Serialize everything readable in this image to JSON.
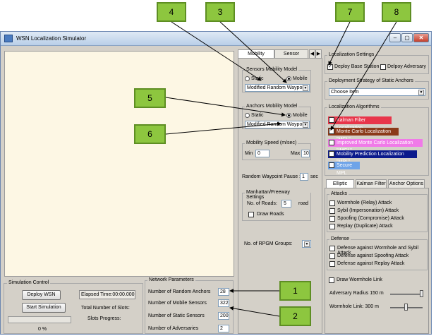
{
  "window": {
    "title": "WSN Localization Simulator",
    "min": "–",
    "max": "▢",
    "close": "✕"
  },
  "mobility_panel": {
    "tabs": [
      "Mobility Settings",
      "Sensor Settings"
    ],
    "tab_arrows": [
      "◀",
      "▶"
    ],
    "sensors_group": "Sensors Mobility Model",
    "anchors_group": "Anchors Mobility Model",
    "static_label": "Static",
    "mobile_label": "Mobile",
    "sensors_model": "Modified Random Waypoint",
    "anchors_model": "Modified Random Waypoint",
    "speed_group": "Mobility Speed  (m/sec)",
    "min_label": "Min",
    "min_value": "0",
    "max_label": "Max",
    "max_value": "10",
    "pause_label": "Random Waypoint Pause :",
    "pause_value": "1",
    "pause_unit": "sec",
    "manhattan_group": "Manhattan/Freeway Settings",
    "roads_label": "No. of Roads:",
    "roads_value": "5",
    "roads_unit": "road",
    "draw_roads": "Draw Roads",
    "rpgm_label": "No. of RPGM Groups:",
    "rpgm_value": ""
  },
  "localization": {
    "group": "Localization Settings",
    "deploy_base": "Deploy Base Station",
    "deploy_adversary": "Delpoy Adversary",
    "deployment_group": "Deployment Strategy of Static Anchors",
    "choose_item": "Choose Item",
    "algorithms_group": "Localization Algorithms",
    "algorithms": [
      {
        "label": "Kalman Filter Localization",
        "color": "#e8354a",
        "checked": false
      },
      {
        "label": "Monte Carlo Localization \"MCL\"",
        "color": "#8b3a1a",
        "checked": true
      },
      {
        "label": "Improved Monte Carlo Localization \"IMCL\"",
        "color": "#f07ae8",
        "checked": false
      },
      {
        "label": "Mobility Prediction Localization \"MPL\"",
        "color": "#0b1a8c",
        "checked": false
      },
      {
        "label": "Secure MPL",
        "color": "#6fa4e8",
        "checked": false
      }
    ],
    "sub_tabs": [
      "Elliptic Curve",
      "Kalman Filter",
      "Anchor Options"
    ],
    "attacks_group": "Attacks",
    "attacks": [
      "Wormhole (Relay) Attack",
      "Sybil (Impersonation) Attack",
      "Spoofing (Compromise) Attack",
      "Replay (Duplicate) Attack"
    ],
    "defense_group": "Defense",
    "defenses": [
      "Defense against Wormhole and Sybil Attack",
      "Defense against Spoofing Attack",
      "Defense against Replay Attack"
    ],
    "draw_wormhole": "Draw Wormhole Link",
    "adversary_radius": "Adversary Radius 150  m",
    "wormhole_link": "Wormhole Link:   300  m"
  },
  "simulation": {
    "group": "Simulation Control",
    "deploy_btn": "Deploy WSN",
    "start_btn": "Start Simulation",
    "elapsed": "Elapsed Time:00:00.000",
    "total_slots": "Total Number of Slots:",
    "slots_progress": "Slots Progress:",
    "progress_text": "0 %",
    "progress": 0
  },
  "network": {
    "group": "Network Parameters",
    "params": [
      {
        "label": "Number of Random Anchors",
        "value": "28"
      },
      {
        "label": "Number of Mobile Sensors",
        "value": "322"
      },
      {
        "label": "Number of Static Sensors",
        "value": "200"
      },
      {
        "label": "Number of Adversaries",
        "value": "2"
      }
    ]
  },
  "callouts": [
    "1",
    "2",
    "3",
    "4",
    "5",
    "6",
    "7",
    "8"
  ]
}
